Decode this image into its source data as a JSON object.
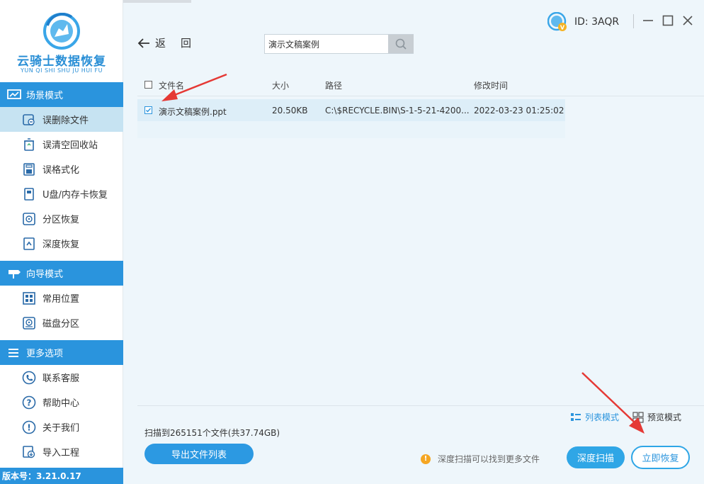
{
  "app": {
    "logo_title": "云骑士数据恢复",
    "logo_subtitle": "YUN QI SHI SHU JU HUI FU",
    "version": "版本号：3.21.0.17"
  },
  "sidebar": {
    "sections": [
      {
        "label": "场景模式",
        "icon": "scene-icon"
      },
      {
        "label": "向导模式",
        "icon": "signpost-icon"
      },
      {
        "label": "更多选项",
        "icon": "menu-icon"
      }
    ],
    "scene_items": [
      {
        "label": "误删除文件",
        "icon": "deleted-file-icon",
        "active": true
      },
      {
        "label": "误清空回收站",
        "icon": "recycle-bin-icon"
      },
      {
        "label": "误格式化",
        "icon": "format-disk-icon"
      },
      {
        "label": "U盘/内存卡恢复",
        "icon": "usb-card-icon"
      },
      {
        "label": "分区恢复",
        "icon": "partition-icon"
      },
      {
        "label": "深度恢复",
        "icon": "deep-recovery-icon"
      }
    ],
    "guide_items": [
      {
        "label": "常用位置",
        "icon": "windows-icon"
      },
      {
        "label": "磁盘分区",
        "icon": "disk-icon"
      }
    ],
    "more_items": [
      {
        "label": "联系客服",
        "icon": "phone-icon"
      },
      {
        "label": "帮助中心",
        "icon": "help-icon"
      },
      {
        "label": "关于我们",
        "icon": "info-icon"
      },
      {
        "label": "导入工程",
        "icon": "import-icon"
      }
    ]
  },
  "topbar": {
    "back_label_1": "返",
    "back_label_2": "回",
    "search_value": "演示文稿案例",
    "user_id": "ID: 3AQR"
  },
  "table": {
    "columns": [
      "文件名",
      "大小",
      "路径",
      "修改时间"
    ],
    "rows": [
      {
        "checked": true,
        "name": "演示文稿案例.ppt",
        "size": "20.50KB",
        "path": "C:\\$RECYCLE.BIN\\S-1-5-21-4200...",
        "modified": "2022-03-23 01:25:02"
      }
    ]
  },
  "footer": {
    "scan_info": "扫描到265151个文件(共37.74GB)",
    "export_label": "导出文件列表",
    "list_mode_label": "列表模式",
    "preview_mode_label": "预览模式",
    "hint": "深度扫描可以找到更多文件",
    "deep_scan_label": "深度扫描",
    "recover_label": "立即恢复"
  },
  "colors": {
    "accent": "#2a94dd",
    "active_nav": "#c6e3f2",
    "selected_row": "#ddeef8",
    "arrow": "#e53935"
  }
}
